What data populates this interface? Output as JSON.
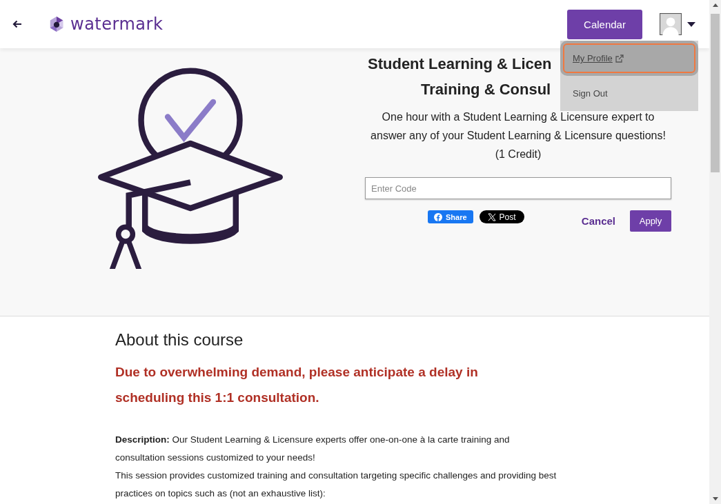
{
  "header": {
    "logo_text": "watermark",
    "calendar_button": "Calendar"
  },
  "user_menu": {
    "expanded": true,
    "items": [
      {
        "label": "My Profile",
        "selected": true,
        "external": true
      },
      {
        "label": "Sign Out",
        "selected": false,
        "external": false
      }
    ]
  },
  "course": {
    "title_lines": [
      "Student Learning & Licen",
      "Training & Consul"
    ],
    "summary": "One hour with a Student Learning & Licensure expert to answer any of your Student Learning & Licensure questions! (1 Credit)",
    "code_field": {
      "placeholder": "Enter Code"
    },
    "share_buttons": [
      {
        "kind": "facebook",
        "label": "Share"
      },
      {
        "kind": "x",
        "label": "Post"
      }
    ],
    "cancel_label": "Cancel",
    "apply_label": "Apply"
  },
  "about": {
    "heading": "About this course",
    "notice": "Due to overwhelming demand, please anticipate a delay in scheduling this 1:1 consultation.",
    "paragraphs": [
      "**Description:** Our Student Learning & Licensure experts offer one-on-one à la carte training and consultation sessions customized to your needs!",
      "This session provides customized training and consultation targeting specific challenges and providing best practices on topics such as (not an exhaustive list):"
    ]
  }
}
